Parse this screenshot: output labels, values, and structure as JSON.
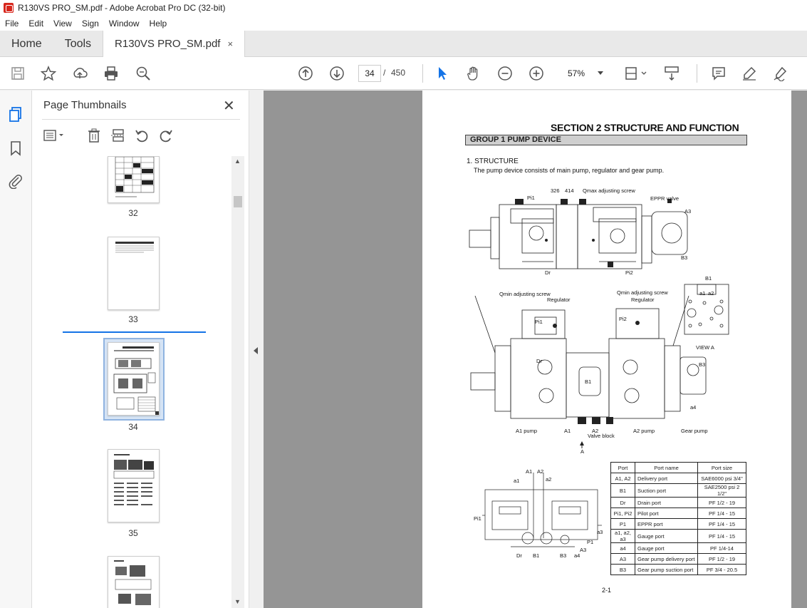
{
  "window": {
    "title": "R130VS PRO_SM.pdf - Adobe Acrobat Pro DC (32-bit)"
  },
  "menu": [
    "File",
    "Edit",
    "View",
    "Sign",
    "Window",
    "Help"
  ],
  "tabs": {
    "home": "Home",
    "tools": "Tools",
    "document": "R130VS PRO_SM.pdf",
    "close_glyph": "×"
  },
  "toolbar": {
    "icons": [
      "save-icon",
      "star-icon",
      "upload-icon",
      "print-icon",
      "zoom-search-icon",
      "prev-page-icon",
      "next-page-icon",
      "select-cursor-icon",
      "hand-icon",
      "zoom-out-icon",
      "zoom-in-icon",
      "fit-page-icon",
      "scroll-mode-icon",
      "comment-icon",
      "highlight-icon",
      "sign-icon"
    ],
    "page_current": "34",
    "page_separator": "/",
    "page_total": "450",
    "zoom": "57%"
  },
  "panel": {
    "title": "Page Thumbnails",
    "close_glyph": "✕",
    "thumbnails": [
      {
        "label": "32"
      },
      {
        "label": "33"
      },
      {
        "label": "34",
        "selected": true
      },
      {
        "label": "35"
      },
      {
        "label": ""
      }
    ]
  },
  "document_page": {
    "section_title": "SECTION  2  STRUCTURE AND FUNCTION",
    "group_title": "GROUP  1  PUMP DEVICE",
    "structure_heading": "1. STRUCTURE",
    "structure_desc": "The pump device consists of main pump, regulator and gear pump.",
    "labels": {
      "pi1": "Pi1",
      "n326": "326",
      "n414": "414",
      "qmax": "Qmax adjusting screw",
      "eppr": "EPPR valve",
      "a3": "A3",
      "b3": "B3",
      "dr": "Dr",
      "pi2": "Pi2",
      "qmin1": "Qmin adjusting screw",
      "qmin2": "Qmin adjusting screw",
      "reg1": "Regulator",
      "reg2": "Regulator",
      "b1": "B1",
      "a1": "a1",
      "a2": "a2",
      "view_a": "VIEW  A",
      "a1_pump": "A1 pump",
      "a2_pump": "A2 pump",
      "gear_pump": "Gear pump",
      "valve_block": "Valve block",
      "A1": "A1",
      "A2": "A2",
      "arrow_a": "A",
      "a4": "a4",
      "a3s": "a3",
      "p1": "P1",
      "b3s": "B3",
      "a4s": "a4",
      "b1s": "B1",
      "drs": "Dr",
      "pi1s": "Pi1",
      "pi2s": "Pi2",
      "a1s": "a1",
      "a2s": "a2"
    },
    "port_table": {
      "headers": [
        "Port",
        "Port name",
        "Port size"
      ],
      "rows": [
        [
          "A1, A2",
          "Delivery port",
          "SAE6000 psi 3/4\""
        ],
        [
          "B1",
          "Suction port",
          "SAE2500 psi 2 1/2\""
        ],
        [
          "Dr",
          "Drain port",
          "PF 1/2 - 19"
        ],
        [
          "Pi1, Pi2",
          "Pilot port",
          "PF 1/4 - 15"
        ],
        [
          "P1",
          "EPPR port",
          "PF 1/4 - 15"
        ],
        [
          "a1, a2, a3",
          "Gauge port",
          "PF 1/4 - 15"
        ],
        [
          "a4",
          "Gauge port",
          "PF 1/4-14"
        ],
        [
          "A3",
          "Gear pump delivery port",
          "PF 1/2 - 19"
        ],
        [
          "B3",
          "Gear pump suction port",
          "PF 3/4 - 20.5"
        ]
      ]
    },
    "page_number": "2-1"
  }
}
